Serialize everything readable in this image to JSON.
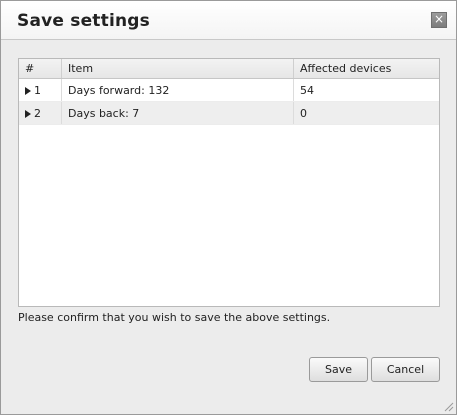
{
  "dialog": {
    "title": "Save settings",
    "close_glyph": "×"
  },
  "table": {
    "columns": [
      "#",
      "Item",
      "Affected devices"
    ],
    "rows": [
      {
        "num": "1",
        "item": "Days forward: 132",
        "affected": "54"
      },
      {
        "num": "2",
        "item": "Days back: 7",
        "affected": "0"
      }
    ]
  },
  "confirm_text": "Please confirm that you wish to save the above settings.",
  "buttons": {
    "save_label": "Save",
    "cancel_label": "Cancel"
  },
  "icons": {
    "close": "close-icon",
    "expand": "triangle-right-icon",
    "resize": "resize-grip-icon"
  }
}
